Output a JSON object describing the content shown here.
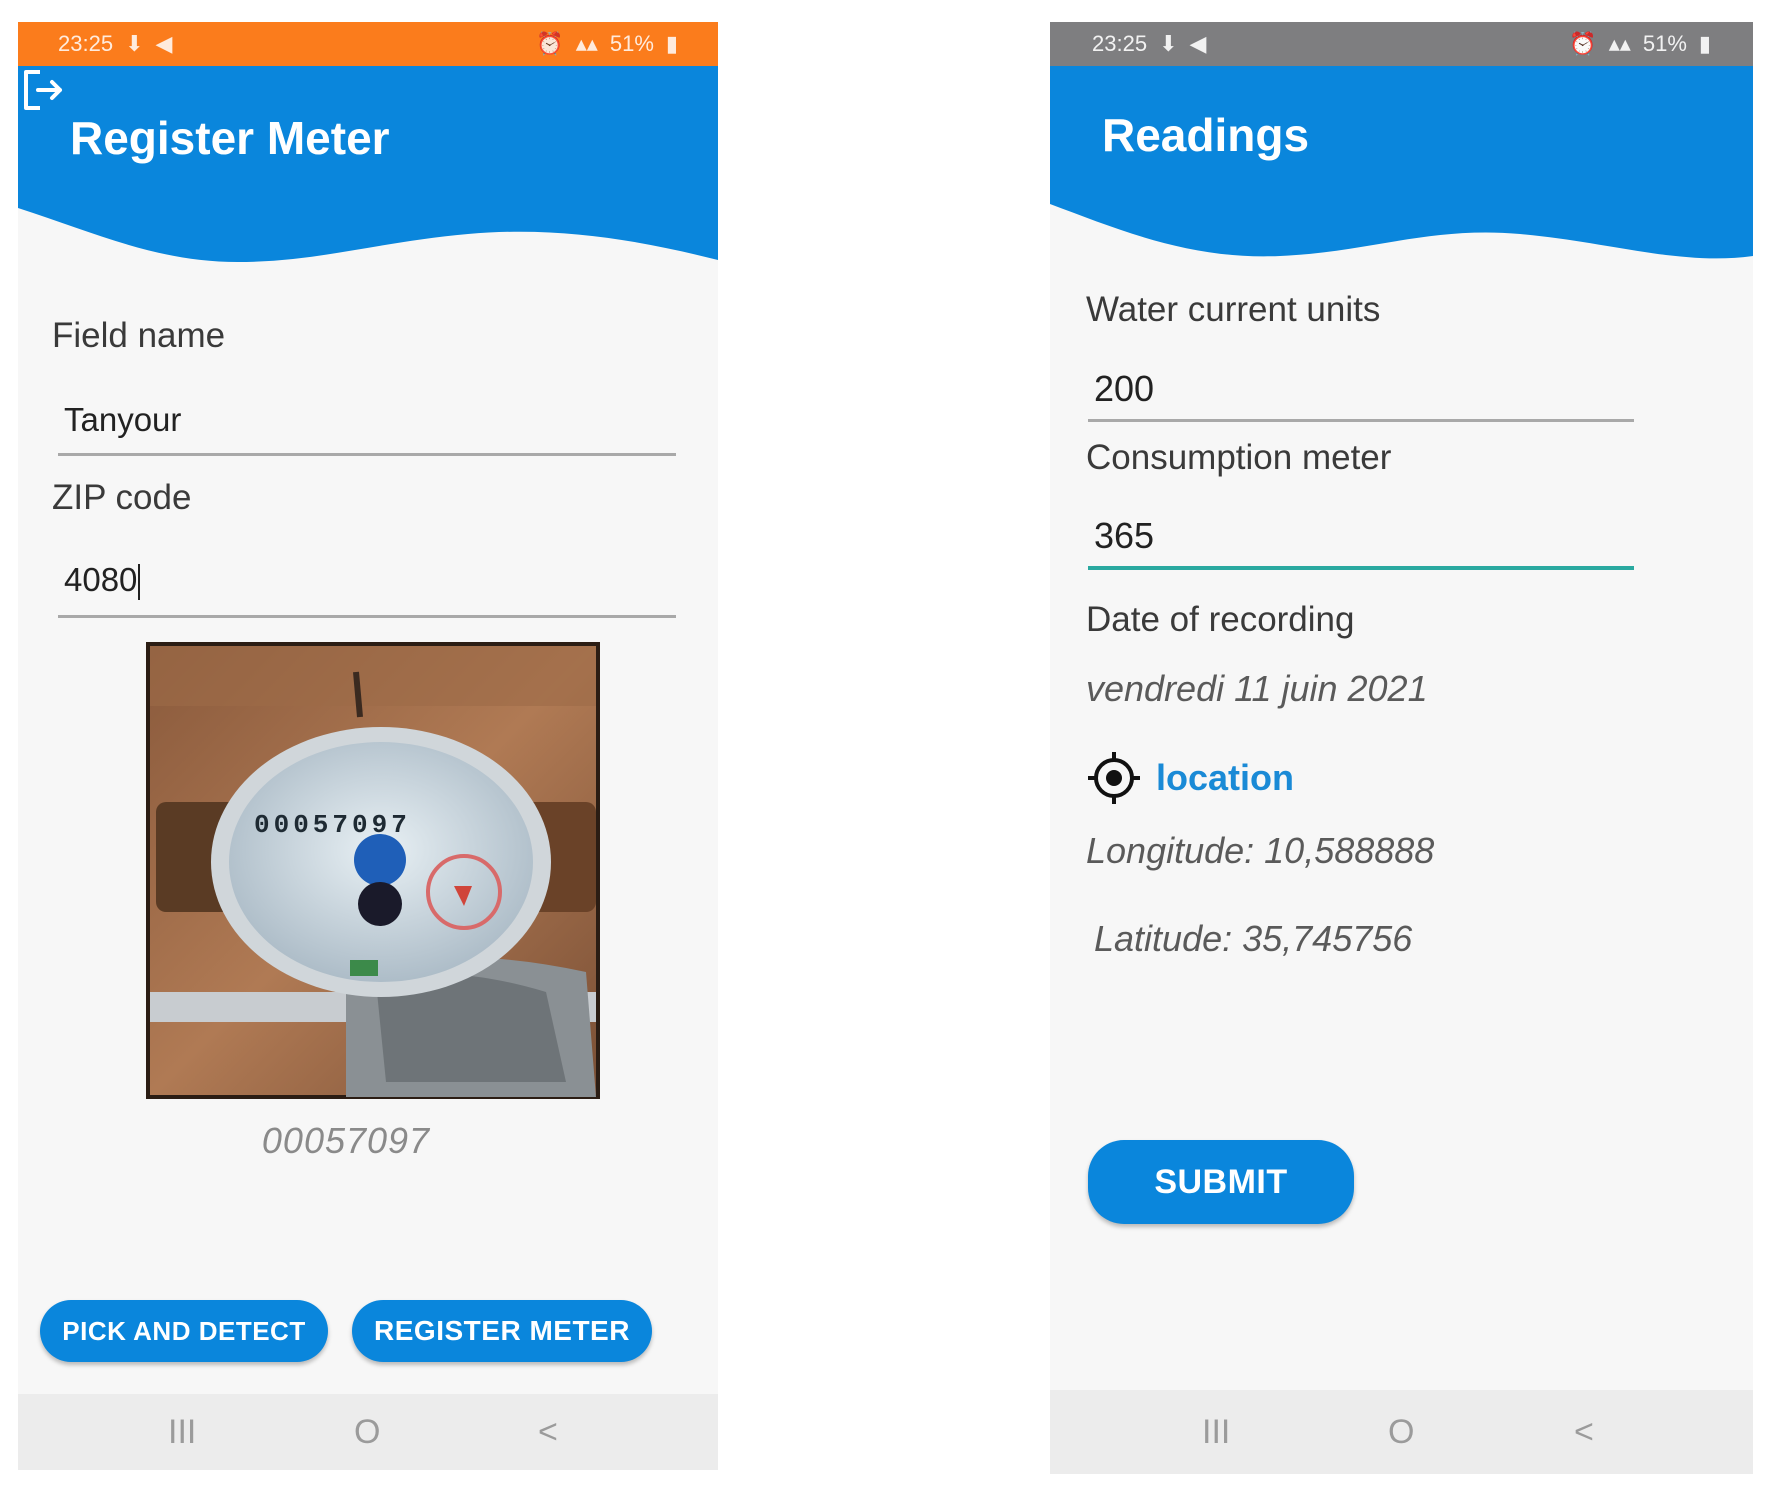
{
  "left_screen": {
    "status_bar": {
      "time": "23:25",
      "battery": "51%"
    },
    "header": {
      "title": "Register Meter"
    },
    "field_name": {
      "label": "Field name",
      "value": "Tanyour"
    },
    "zip_code": {
      "label": "ZIP code",
      "value": "4080"
    },
    "meter_digits": "00057097",
    "meter_caption": "00057097",
    "buttons": {
      "pick_and_detect": "PICK AND DETECT",
      "register_meter": "REGISTER METER"
    },
    "nav": {
      "recent": "III",
      "home": "O",
      "back": "<"
    }
  },
  "right_screen": {
    "status_bar": {
      "time": "23:25",
      "battery": "51%"
    },
    "header": {
      "title": "Readings"
    },
    "water_current_units": {
      "label": "Water current units",
      "value": "200"
    },
    "consumption_meter": {
      "label": "Consumption meter",
      "value": "365"
    },
    "date_of_recording": {
      "label": "Date of recording",
      "value": "vendredi 11 juin 2021"
    },
    "location": {
      "label": "location",
      "longitude": "Longitude: 10,588888",
      "latitude": "Latitude: 35,745756"
    },
    "buttons": {
      "submit": "SUBMIT"
    },
    "nav": {
      "recent": "III",
      "home": "O",
      "back": "<"
    }
  },
  "colors": {
    "header_blue": "#0a86dc",
    "status_orange": "#fb7c1c",
    "status_gray": "#7e7e80",
    "accent_teal": "#2aa9a0",
    "link_blue": "#1a8ad6"
  },
  "icons": [
    "logout-icon",
    "location-target-icon",
    "signal-icon",
    "battery-icon"
  ]
}
